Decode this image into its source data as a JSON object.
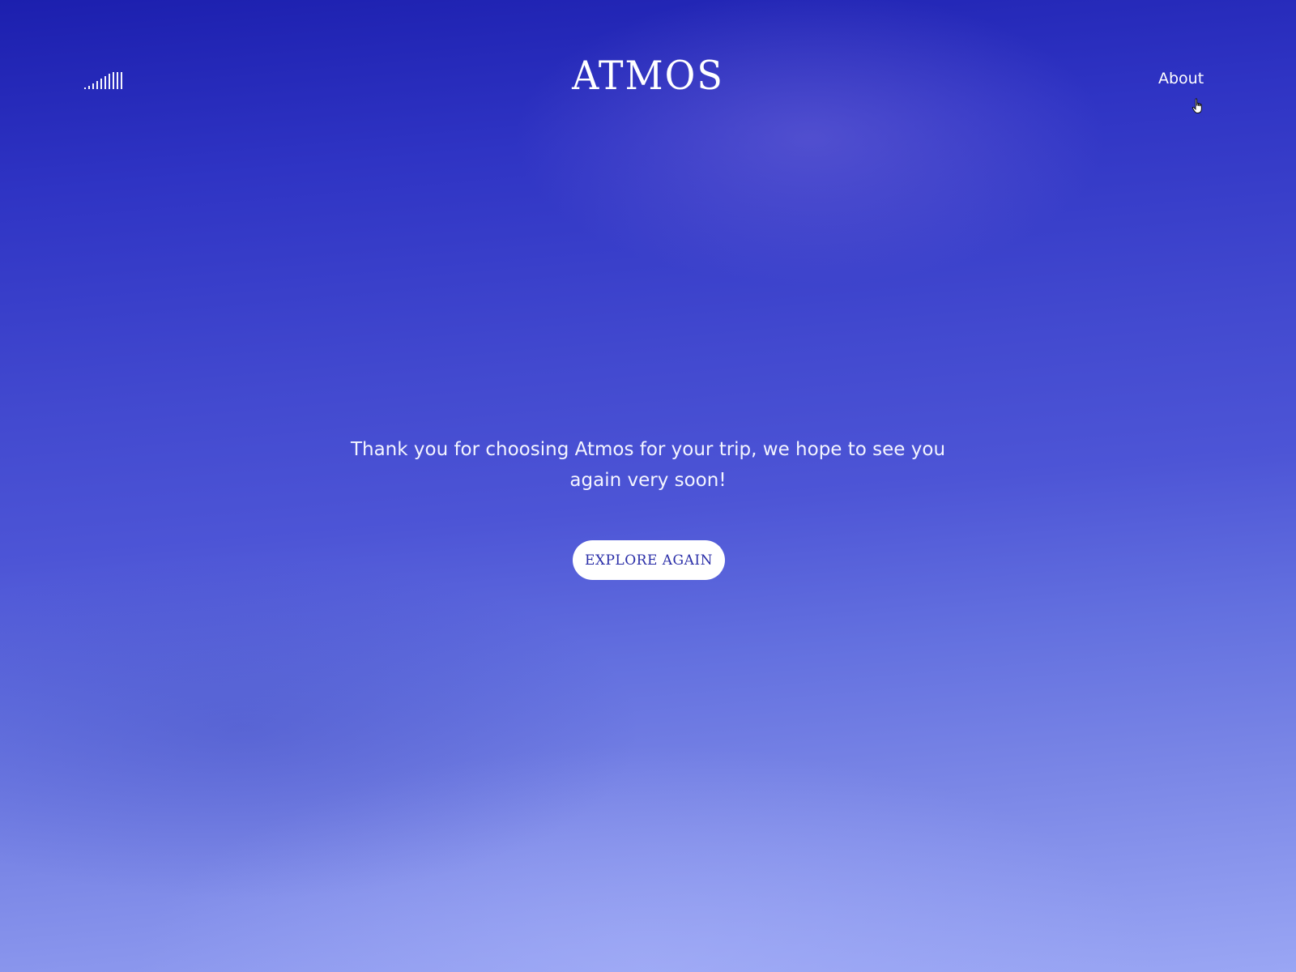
{
  "header": {
    "logo": "ATMOS",
    "about_label": "About",
    "sound_icon": "sound-bars-icon"
  },
  "main": {
    "message": "Thank you for choosing Atmos for your trip, we hope to see you again very soon!",
    "explore_label": "EXPLORE AGAIN"
  },
  "colors": {
    "background_top": "#1c1fae",
    "background_bottom": "#9aa6f4",
    "button_bg": "#ffffff",
    "button_text": "#2a2ea8"
  }
}
